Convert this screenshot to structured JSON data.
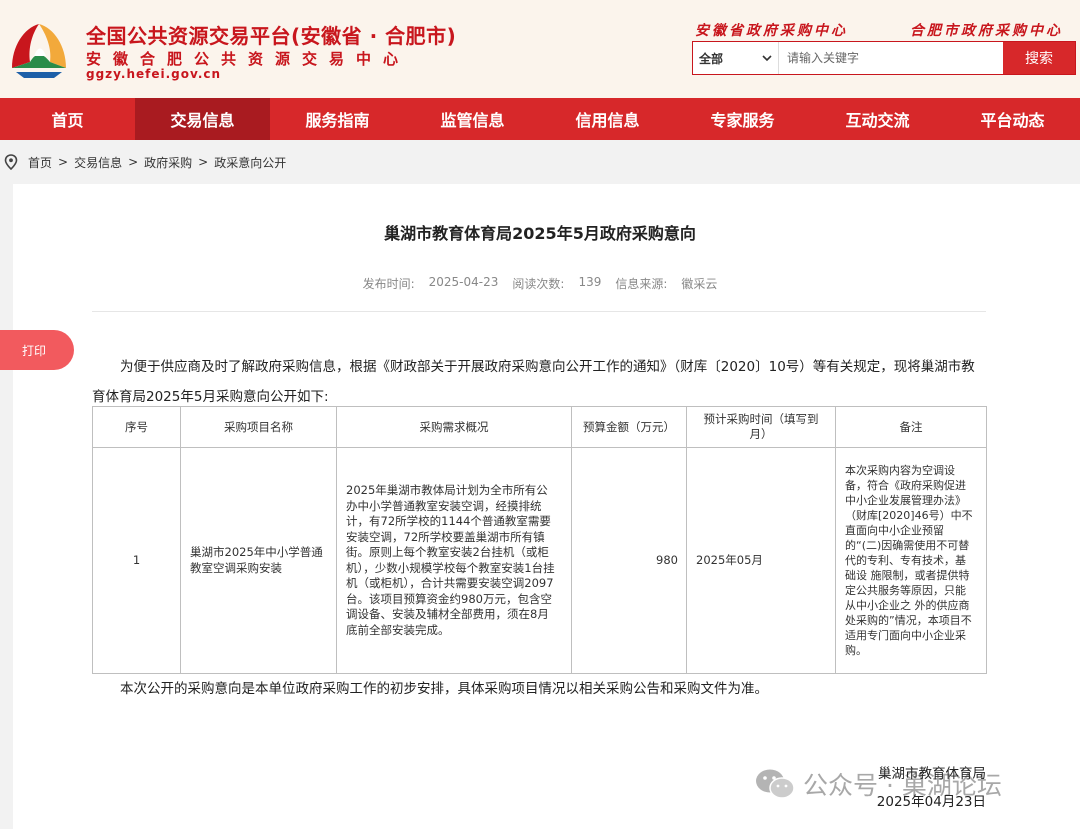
{
  "header": {
    "title": "全国公共资源交易平台(安徽省 · 合肥市)",
    "subtitle": "安徽合肥公共资源交易中心",
    "domain": "ggzy.hefei.gov.cn",
    "links": [
      "安徽省政府采购中心",
      "合肥市政府采购中心"
    ],
    "search": {
      "selected": "全部",
      "placeholder": "请输入关键字",
      "button": "搜索"
    }
  },
  "nav": {
    "items": [
      "首页",
      "交易信息",
      "服务指南",
      "监管信息",
      "信用信息",
      "专家服务",
      "互动交流",
      "平台动态"
    ],
    "active_index": 1
  },
  "breadcrumb": [
    "首页",
    "交易信息",
    "政府采购",
    "政采意向公开"
  ],
  "article": {
    "title": "巢湖市教育体育局2025年5月政府采购意向",
    "meta": {
      "publish_label": "发布时间:",
      "publish_date": "2025-04-23",
      "views_label": "阅读次数:",
      "views": "139",
      "source_label": "信息来源:",
      "source": "徽采云"
    },
    "print": "打印",
    "intro": "为便于供应商及时了解政府采购信息，根据《财政部关于开展政府采购意向公开工作的通知》（财库〔2020〕10号）等有关规定，现将巢湖市教育体育局2025年5月采购意向公开如下:",
    "table": {
      "headers": [
        "序号",
        "采购项目名称",
        "采购需求概况",
        "预算金额（万元）",
        "预计采购时间（填写到月）",
        "备注"
      ],
      "rows": [
        {
          "no": "1",
          "name": "巢湖市2025年中小学普通教室空调采购安装",
          "requirement": "2025年巢湖市教体局计划为全市所有公办中小学普通教室安装空调，经摸排统计，有72所学校的1144个普通教室需要安装空调，72所学校要盖巢湖市所有镇街。原则上每个教室安装2台挂机（或柜机），少数小规模学校每个教室安装1台挂机（或柜机），合计共需要安装空调2097台。该项目预算资金约980万元，包含空调设备、安装及辅材全部费用，须在8月底前全部安装完成。",
          "budget": "980",
          "time": "2025年05月",
          "note": "本次采购内容为空调设备，符合《政府采购促进中小企业发展管理办法》（财库[2020]46号）中不直面向中小企业预留的“(二)因确需使用不可替代的专利、专有技术，基础设 施限制，或者提供特定公共服务等原因，只能从中小企业之 外的供应商处采购的”情况，本项目不适用专门面向中小企业采购。"
        }
      ]
    },
    "footnote": "本次公开的采购意向是本单位政府采购工作的初步安排，具体采购项目情况以相关采购公告和采购文件为准。",
    "signature": {
      "org": "巢湖市教育体育局",
      "date": "2025年04月23日"
    }
  },
  "watermark": "公众号 · 巢湖论坛",
  "colors": {
    "brand_red": "#d7282a",
    "nav_active": "#a91b20",
    "header_bg": "#fbf4ec",
    "print_button": "#f25a5e"
  }
}
